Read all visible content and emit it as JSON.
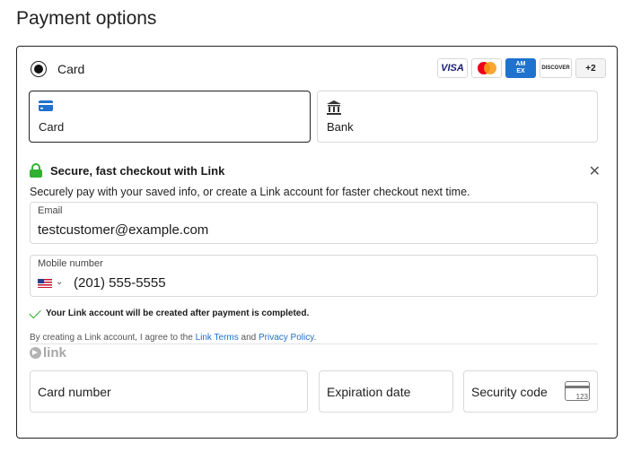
{
  "page": {
    "title": "Payment options"
  },
  "payment_method": {
    "label": "Card",
    "selected": true
  },
  "card_brands": {
    "visa": "VISA",
    "amex_line1": "AM",
    "amex_line2": "EX",
    "discover": "DISCOVER",
    "more": "+2",
    "icons": [
      "visa-icon",
      "mastercard-icon",
      "amex-icon",
      "discover-icon"
    ]
  },
  "tabs": [
    {
      "label": "Card",
      "icon": "card-icon",
      "selected": true
    },
    {
      "label": "Bank",
      "icon": "bank-icon",
      "selected": false
    }
  ],
  "link": {
    "heading": "Secure, fast checkout with Link",
    "subtitle": "Securely pay with your saved info, or create a Link account for faster checkout next time.",
    "email_label": "Email",
    "email_value": "testcustomer@example.com",
    "phone_label": "Mobile number",
    "phone_value": "(201) 555-5555",
    "phone_country_icon": "us-flag-icon",
    "confirmation": "Your Link account will be created after payment is completed.",
    "terms_prefix": "By creating a Link account, I agree to the ",
    "terms_link": "Link Terms",
    "terms_and": " and ",
    "privacy_link": "Privacy Policy",
    "terms_suffix": ".",
    "logo_text": "link"
  },
  "card_fields": {
    "number_placeholder": "Card number",
    "expiry_placeholder": "Expiration date",
    "cvc_placeholder": "Security code",
    "cvc_hint": "123"
  },
  "colors": {
    "accent_green": "#30b130",
    "link_blue": "#1f6fcf",
    "border": "#d9d9d9"
  }
}
